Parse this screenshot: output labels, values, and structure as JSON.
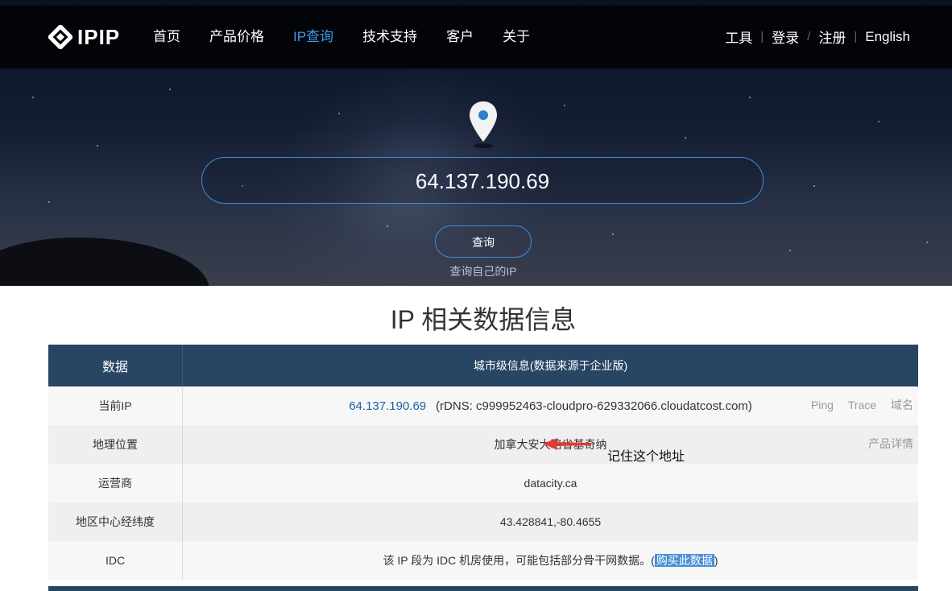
{
  "header": {
    "logo_text": "IPIP",
    "nav": [
      {
        "label": "首页"
      },
      {
        "label": "产品价格"
      },
      {
        "label": "IP查询"
      },
      {
        "label": "技术支持"
      },
      {
        "label": "客户"
      },
      {
        "label": "关于"
      }
    ],
    "right_nav": {
      "tools": "工具",
      "login": "登录",
      "register": "注册",
      "english": "English"
    },
    "active_color": "#3d9cf0"
  },
  "search": {
    "ip_value": "64.137.190.69",
    "button_label": "查询",
    "self_ip_link": "查询自己的IP"
  },
  "section": {
    "title": "IP 相关数据信息"
  },
  "table": {
    "header": {
      "col1": "数据",
      "col2": "城市级信息(数据来源于企业版)"
    },
    "rows": {
      "current_ip": {
        "label": "当前IP",
        "ip": "64.137.190.69",
        "rdns": "(rDNS: c999952463-cloudpro-629332066.cloudatcost.com)",
        "tools": [
          "Ping",
          "Trace",
          "域名"
        ]
      },
      "location": {
        "label": "地理位置",
        "value": "加拿大安大略省基奇纳",
        "detail_link": "产品详情"
      },
      "isp": {
        "label": "运营商",
        "value": "datacity.ca"
      },
      "coords": {
        "label": "地区中心经纬度",
        "value": "43.428841,-80.4655"
      },
      "idc": {
        "label": "IDC",
        "value_prefix": "该 IP 段为 IDC 机房使用，可能包括部分骨干网数据。(",
        "buy_link": "购买此数据",
        "value_suffix": ")"
      }
    },
    "header_color": "#284564"
  },
  "annotation": {
    "text": "记住这个地址",
    "arrow_color": "#e53935"
  }
}
